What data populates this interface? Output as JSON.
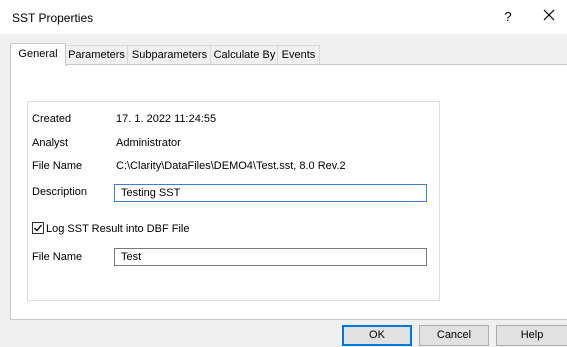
{
  "window": {
    "title": "SST Properties",
    "help_glyph": "?"
  },
  "tabs": [
    {
      "label": "General",
      "active": true
    },
    {
      "label": "Parameters"
    },
    {
      "label": "Subparameters"
    },
    {
      "label": "Calculate By"
    },
    {
      "label": "Events"
    }
  ],
  "general": {
    "created_label": "Created",
    "created_value": "17. 1. 2022 11:24:55",
    "analyst_label": "Analyst",
    "analyst_value": "Administrator",
    "filename_label": "File Name",
    "filename_value": "C:\\Clarity\\DataFiles\\DEMO4\\Test.sst, 8.0 Rev.2",
    "description_label": "Description",
    "description_value": "Testing SST",
    "log_label": "Log SST Result into DBF File",
    "log_checked": true,
    "dbf_filename_label": "File Name",
    "dbf_filename_value": "Test"
  },
  "buttons": {
    "ok": "OK",
    "cancel": "Cancel",
    "help": "Help"
  }
}
